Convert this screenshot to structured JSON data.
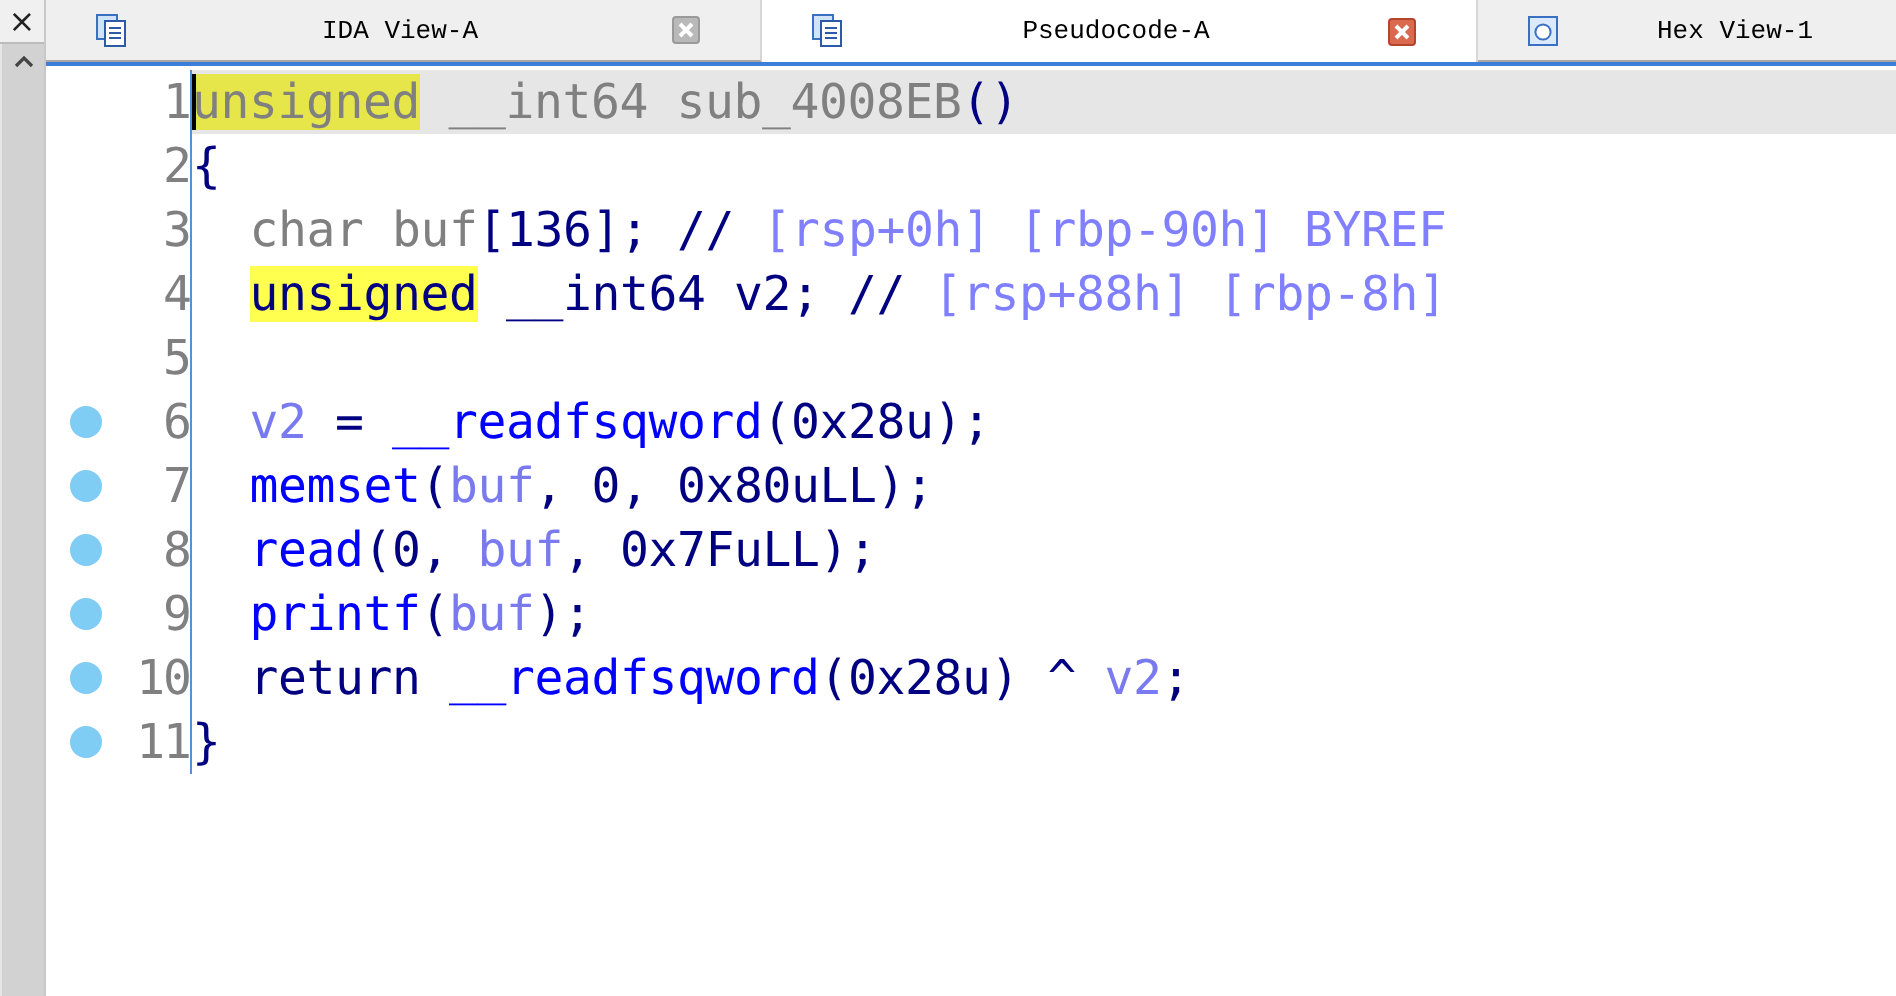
{
  "side_panel": {
    "close": "×"
  },
  "tabs": [
    {
      "label": "IDA View-A",
      "selected": false,
      "close_shown": true
    },
    {
      "label": "Pseudocode-A",
      "selected": true,
      "close_shown": true
    },
    {
      "label": "Hex View-1",
      "selected": false,
      "close_shown": false
    }
  ],
  "lines": [
    {
      "number": "1",
      "breakpoint": false,
      "current": true,
      "indent": false,
      "tokens": [
        {
          "text": "unsigned",
          "kind": "gray",
          "marked": true
        },
        {
          "text": " __int64 sub_4008EB",
          "kind": "gray",
          "marked": false
        },
        {
          "text": "()",
          "kind": "plain",
          "marked": false
        }
      ]
    },
    {
      "number": "2",
      "breakpoint": false,
      "current": false,
      "indent": false,
      "tokens": [
        {
          "text": "{",
          "kind": "plain",
          "marked": false
        }
      ]
    },
    {
      "number": "3",
      "breakpoint": false,
      "current": false,
      "indent": true,
      "tokens": [
        {
          "text": "char buf",
          "kind": "gray",
          "marked": false
        },
        {
          "text": "[136]; // ",
          "kind": "plain",
          "marked": false
        },
        {
          "text": "[rsp+0h] [rbp-90h] BYREF",
          "kind": "comment",
          "marked": false
        }
      ]
    },
    {
      "number": "4",
      "breakpoint": false,
      "current": false,
      "indent": true,
      "tokens": [
        {
          "text": "unsigned",
          "kind": "plain",
          "marked": true
        },
        {
          "text": " __int64 v2; // ",
          "kind": "plain",
          "marked": false
        },
        {
          "text": "[rsp+88h] [rbp-8h]",
          "kind": "comment",
          "marked": false
        }
      ]
    },
    {
      "number": "5",
      "breakpoint": false,
      "current": false
    },
    {
      "number": "6",
      "breakpoint": true,
      "current": false,
      "indent": true,
      "tokens": [
        {
          "text": "v2",
          "kind": "var",
          "marked": false
        },
        {
          "text": " = ",
          "kind": "plain",
          "marked": false
        },
        {
          "text": "__readfsqword",
          "kind": "func",
          "marked": false
        },
        {
          "text": "(0x28u);",
          "kind": "plain",
          "marked": false
        }
      ]
    },
    {
      "number": "7",
      "breakpoint": true,
      "current": false,
      "indent": true,
      "tokens": [
        {
          "text": "memset",
          "kind": "func",
          "marked": false
        },
        {
          "text": "(",
          "kind": "plain",
          "marked": false
        },
        {
          "text": "buf",
          "kind": "var",
          "marked": false
        },
        {
          "text": ", 0, 0x80uLL);",
          "kind": "plain",
          "marked": false
        }
      ]
    },
    {
      "number": "8",
      "breakpoint": true,
      "current": false,
      "indent": true,
      "tokens": [
        {
          "text": "read",
          "kind": "func",
          "marked": false
        },
        {
          "text": "(0, ",
          "kind": "plain",
          "marked": false
        },
        {
          "text": "buf",
          "kind": "var",
          "marked": false
        },
        {
          "text": ", 0x7FuLL);",
          "kind": "plain",
          "marked": false
        }
      ]
    },
    {
      "number": "9",
      "breakpoint": true,
      "current": false,
      "indent": true,
      "tokens": [
        {
          "text": "printf",
          "kind": "func",
          "marked": false
        },
        {
          "text": "(",
          "kind": "plain",
          "marked": false
        },
        {
          "text": "buf",
          "kind": "var",
          "marked": false
        },
        {
          "text": ");",
          "kind": "plain",
          "marked": false
        }
      ]
    },
    {
      "number": "10",
      "breakpoint": true,
      "current": false,
      "indent": true,
      "tokens": [
        {
          "text": "return ",
          "kind": "plain",
          "marked": false
        },
        {
          "text": "__readfsqword",
          "kind": "func",
          "marked": false
        },
        {
          "text": "(0x28u) ^ ",
          "kind": "plain",
          "marked": false
        },
        {
          "text": "v2",
          "kind": "var",
          "marked": false
        },
        {
          "text": ";",
          "kind": "plain",
          "marked": false
        }
      ]
    },
    {
      "number": "11",
      "breakpoint": true,
      "current": false,
      "indent": false,
      "tokens": [
        {
          "text": "}",
          "kind": "plain",
          "marked": false
        }
      ]
    }
  ]
}
